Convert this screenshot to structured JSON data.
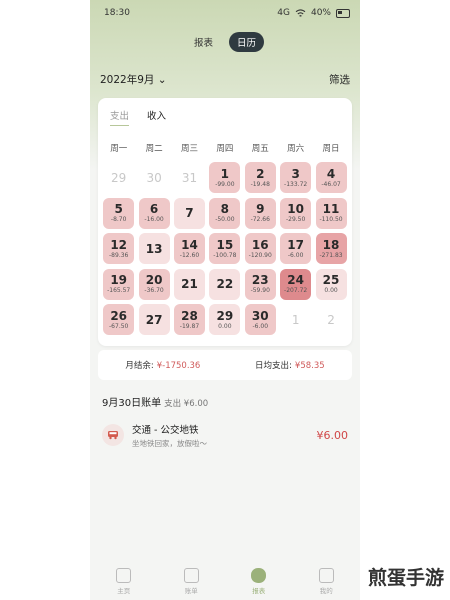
{
  "status": {
    "time": "18:30",
    "signal": "4G",
    "battery": "40%"
  },
  "view_switch": {
    "report": "报表",
    "calendar": "日历"
  },
  "month": {
    "label": "2022年9月",
    "filter": "筛选"
  },
  "tabs": {
    "expense": "支出",
    "income": "收入"
  },
  "weekdays": [
    "周一",
    "周二",
    "周三",
    "周四",
    "周五",
    "周六",
    "周日"
  ],
  "days": [
    {
      "d": "29",
      "v": "",
      "lvl": "muted"
    },
    {
      "d": "30",
      "v": "",
      "lvl": "muted"
    },
    {
      "d": "31",
      "v": "",
      "lvl": "muted"
    },
    {
      "d": "1",
      "v": "-99.00",
      "lvl": "lvl2"
    },
    {
      "d": "2",
      "v": "-19.48",
      "lvl": "lvl2"
    },
    {
      "d": "3",
      "v": "-133.72",
      "lvl": "lvl2"
    },
    {
      "d": "4",
      "v": "-46.07",
      "lvl": "lvl2"
    },
    {
      "d": "5",
      "v": "-8.70",
      "lvl": "lvl2"
    },
    {
      "d": "6",
      "v": "-16.00",
      "lvl": "lvl2"
    },
    {
      "d": "7",
      "v": "",
      "lvl": "lvl1"
    },
    {
      "d": "8",
      "v": "-50.00",
      "lvl": "lvl2"
    },
    {
      "d": "9",
      "v": "-72.66",
      "lvl": "lvl2"
    },
    {
      "d": "10",
      "v": "-29.50",
      "lvl": "lvl2"
    },
    {
      "d": "11",
      "v": "-110.50",
      "lvl": "lvl2"
    },
    {
      "d": "12",
      "v": "-89.36",
      "lvl": "lvl2"
    },
    {
      "d": "13",
      "v": "",
      "lvl": "lvl1"
    },
    {
      "d": "14",
      "v": "-12.60",
      "lvl": "lvl2"
    },
    {
      "d": "15",
      "v": "-100.78",
      "lvl": "lvl2"
    },
    {
      "d": "16",
      "v": "-120.90",
      "lvl": "lvl2"
    },
    {
      "d": "17",
      "v": "-6.00",
      "lvl": "lvl2"
    },
    {
      "d": "18",
      "v": "-271.83",
      "lvl": "lvl3"
    },
    {
      "d": "19",
      "v": "-165.57",
      "lvl": "lvl2"
    },
    {
      "d": "20",
      "v": "-36.70",
      "lvl": "lvl2"
    },
    {
      "d": "21",
      "v": "",
      "lvl": "lvl1"
    },
    {
      "d": "22",
      "v": "",
      "lvl": "lvl1"
    },
    {
      "d": "23",
      "v": "-59.90",
      "lvl": "lvl2"
    },
    {
      "d": "24",
      "v": "-207.72",
      "lvl": "lvl4"
    },
    {
      "d": "25",
      "v": "0.00",
      "lvl": "lvl1"
    },
    {
      "d": "26",
      "v": "-67.50",
      "lvl": "lvl2"
    },
    {
      "d": "27",
      "v": "",
      "lvl": "lvl1"
    },
    {
      "d": "28",
      "v": "-19.87",
      "lvl": "lvl2"
    },
    {
      "d": "29",
      "v": "0.00",
      "lvl": "lvl1"
    },
    {
      "d": "30",
      "v": "-6.00",
      "lvl": "lvl2"
    },
    {
      "d": "1",
      "v": "",
      "lvl": "muted"
    },
    {
      "d": "2",
      "v": "",
      "lvl": "muted"
    }
  ],
  "summary": {
    "monthly_label": "月结余:",
    "monthly_value": "¥-1750.36",
    "daily_label": "日均支出:",
    "daily_value": "¥58.35"
  },
  "bill": {
    "title": "9月30日账单",
    "sub": "支出 ¥6.00",
    "item": {
      "title": "交通 - 公交地铁",
      "note": "坐地铁回家，放假啦～",
      "amount": "¥6.00",
      "icon": "bus-icon"
    }
  },
  "tabbar": [
    "主页",
    "账单",
    "报表",
    "我的"
  ],
  "watermark": "煎蛋手游"
}
